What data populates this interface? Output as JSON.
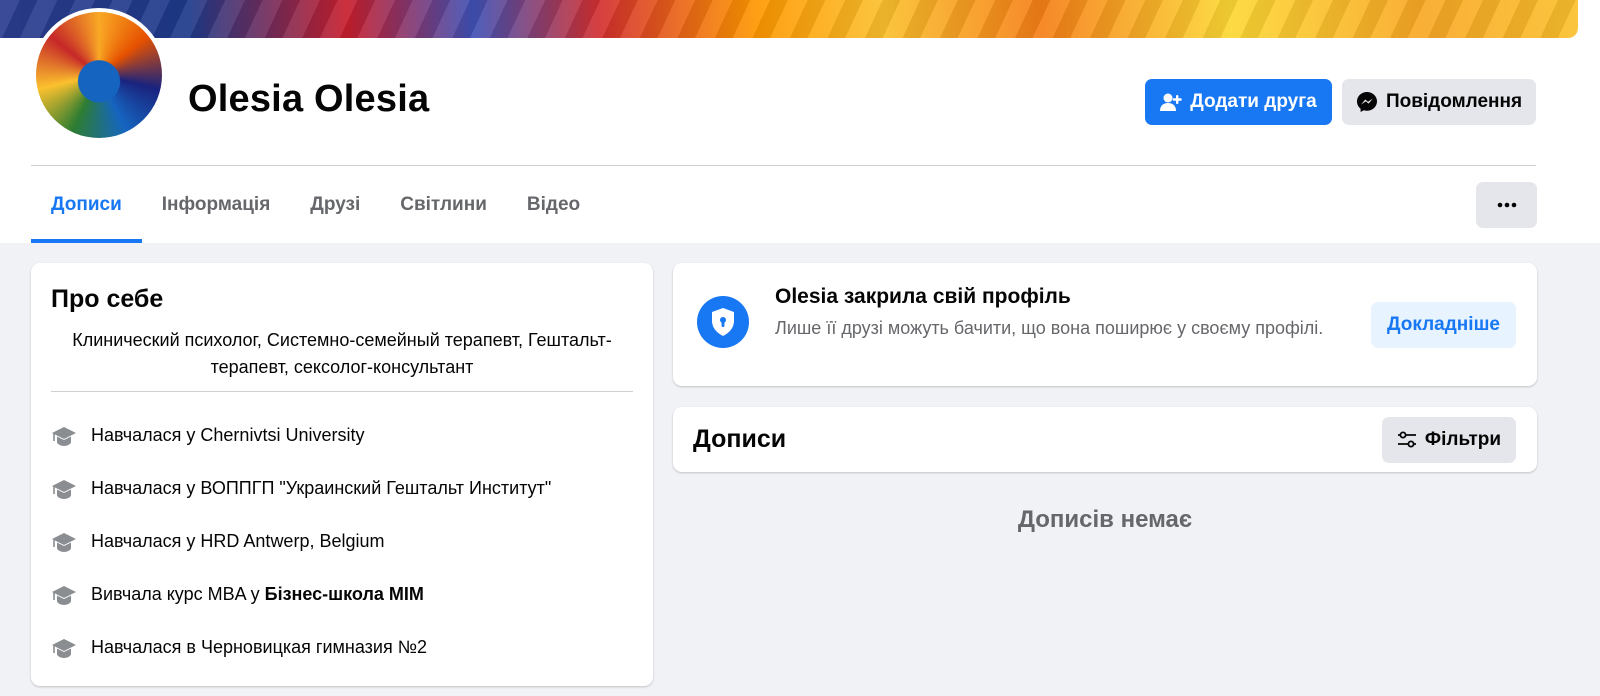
{
  "profile": {
    "name": "Olesia Olesia",
    "add_friend_label": "Додати друга",
    "message_label": "Повідомлення",
    "more_label": "..."
  },
  "tabs": [
    {
      "label": "Дописи",
      "active": true
    },
    {
      "label": "Інформація",
      "active": false
    },
    {
      "label": "Друзі",
      "active": false
    },
    {
      "label": "Світлини",
      "active": false
    },
    {
      "label": "Відео",
      "active": false
    }
  ],
  "about": {
    "title": "Про себе",
    "bio": "Клинический психолог, Системно-семейный терапевт, Гештальт-терапевт, сексолог-консультант",
    "items": [
      {
        "text": "Навчалася у Chernivtsi University",
        "bold": ""
      },
      {
        "text": "Навчалася у ВОППГП \"Украинский Гештальт Институт\"",
        "bold": ""
      },
      {
        "text": "Навчалася у HRD Antwerp, Belgium",
        "bold": ""
      },
      {
        "text": "Вивчала курс MBA у",
        "bold": "Бізнес-школа MIM"
      },
      {
        "text": "Навчалася в Черновицкая гимназия №2",
        "bold": ""
      }
    ]
  },
  "locked": {
    "title": "Olesia закрила свій профіль",
    "description": "Лише її друзі можуть бачити, що вона поширює у своєму профілі.",
    "learn_more_label": "Докладніше"
  },
  "posts": {
    "title": "Дописи",
    "filter_label": "Фільтри",
    "empty_text": "Дописів немає"
  },
  "colors": {
    "accent": "#1877f2",
    "background": "#f0f2f5",
    "secondary_text": "#65676b"
  }
}
